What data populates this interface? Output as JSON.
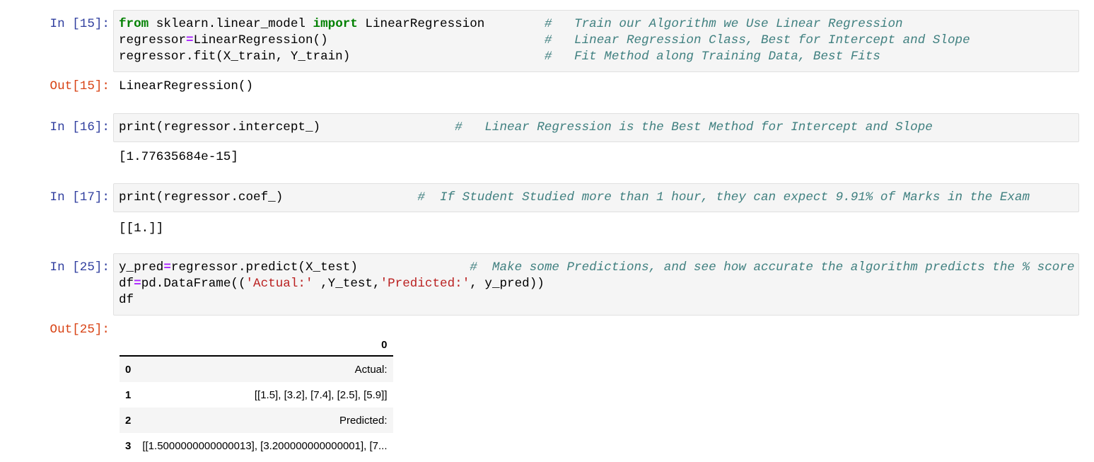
{
  "cells": [
    {
      "prompt": "In [15]:",
      "lines": [
        [
          {
            "t": "kw",
            "s": "from"
          },
          {
            "t": "",
            "s": " sklearn.linear_model "
          },
          {
            "t": "kw",
            "s": "import"
          },
          {
            "t": "",
            "s": " LinearRegression        "
          },
          {
            "t": "cm",
            "s": "#   Train our Algorithm we Use Linear Regression"
          }
        ],
        [
          {
            "t": "",
            "s": "regressor"
          },
          {
            "t": "op",
            "s": "="
          },
          {
            "t": "",
            "s": "LinearRegression()                             "
          },
          {
            "t": "cm",
            "s": "#   Linear Regression Class, Best for Intercept and Slope"
          }
        ],
        [
          {
            "t": "",
            "s": "regressor.fit(X_train, Y_train)                          "
          },
          {
            "t": "cm",
            "s": "#   Fit Method along Training Data, Best Fits"
          }
        ]
      ],
      "out_prompt": "Out[15]:",
      "output": "LinearRegression()"
    },
    {
      "prompt": "In [16]:",
      "lines": [
        [
          {
            "t": "",
            "s": "print(regressor.intercept_)                  "
          },
          {
            "t": "cm",
            "s": "#   Linear Regression is the Best Method for Intercept and Slope"
          }
        ]
      ],
      "output": "[1.77635684e-15]"
    },
    {
      "prompt": "In [17]:",
      "lines": [
        [
          {
            "t": "",
            "s": "print(regressor.coef_)                  "
          },
          {
            "t": "cm",
            "s": "#  If Student Studied more than 1 hour, they can expect 9.91% of Marks in the Exam"
          }
        ]
      ],
      "output": "[[1.]]"
    },
    {
      "prompt": "In [25]:",
      "lines": [
        [
          {
            "t": "",
            "s": "y_pred"
          },
          {
            "t": "op",
            "s": "="
          },
          {
            "t": "",
            "s": "regressor.predict(X_test)               "
          },
          {
            "t": "cm",
            "s": "#  Make some Predictions, and see how accurate the algorithm predicts the % score"
          }
        ],
        [
          {
            "t": "",
            "s": "df"
          },
          {
            "t": "op",
            "s": "="
          },
          {
            "t": "",
            "s": "pd.DataFrame(("
          },
          {
            "t": "str",
            "s": "'Actual:'"
          },
          {
            "t": "",
            "s": " ,Y_test,"
          },
          {
            "t": "str",
            "s": "'Predicted:'"
          },
          {
            "t": "",
            "s": ", y_pred))"
          }
        ],
        [
          {
            "t": "",
            "s": "df"
          }
        ]
      ],
      "out_prompt": "Out[25]:"
    }
  ],
  "dataframe": {
    "columns": [
      "0"
    ],
    "rows": [
      {
        "index": "0",
        "value": "Actual:"
      },
      {
        "index": "1",
        "value": "[[1.5], [3.2], [7.4], [2.5], [5.9]]"
      },
      {
        "index": "2",
        "value": "Predicted:"
      },
      {
        "index": "3",
        "value": "[[1.5000000000000013], [3.200000000000001], [7..."
      }
    ]
  }
}
